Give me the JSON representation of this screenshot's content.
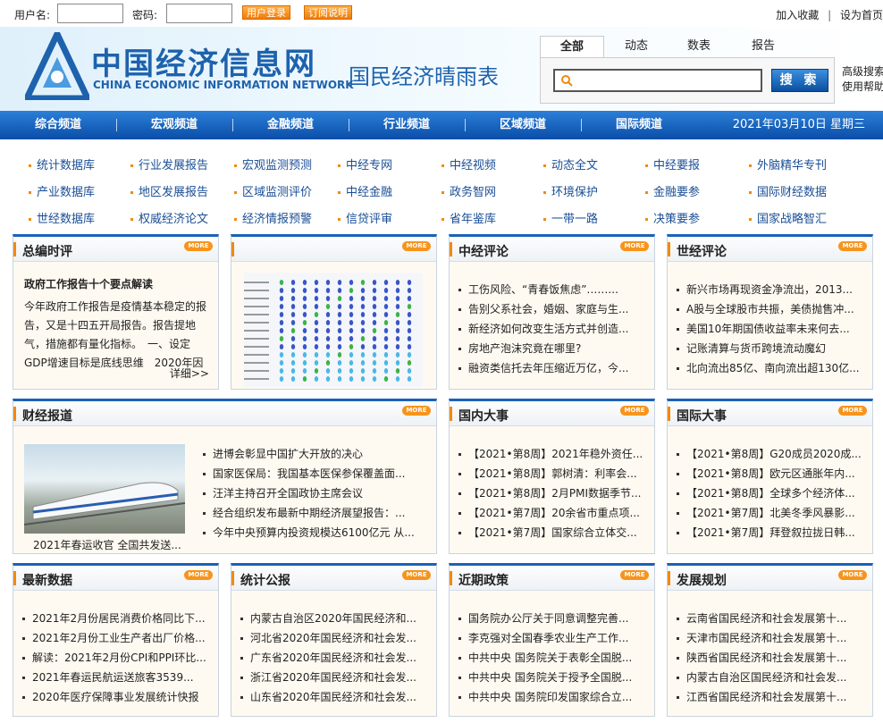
{
  "topbar": {
    "username_label": "用户名:",
    "password_label": "密码:",
    "login_label": "用户登录",
    "subscribe_label": "订阅说明",
    "favorite_label": "加入收藏",
    "sep": "|",
    "homepage_label": "设为首页"
  },
  "header": {
    "logo_cn": "中国经济信息网",
    "logo_en": "CHINA ECONOMIC INFORMATION NETWORK",
    "slogan": "国民经济晴雨表"
  },
  "search": {
    "tabs": [
      "全部",
      "动态",
      "数表",
      "报告"
    ],
    "button": "搜 索",
    "advanced": "高级搜索",
    "help": "使用帮助",
    "placeholder": ""
  },
  "nav": {
    "items": [
      "综合频道",
      "宏观频道",
      "金融频道",
      "行业频道",
      "区域频道",
      "国际频道"
    ],
    "date": "2021年03月10日 星期三"
  },
  "links": [
    [
      "统计数据库",
      "行业发展报告",
      "宏观监测预测",
      "中经专网",
      "中经视频",
      "动态全文",
      "中经要报",
      "外脑精华专刊"
    ],
    [
      "产业数据库",
      "地区发展报告",
      "区域监测评价",
      "中经金融",
      "政务智网",
      "环境保护",
      "金融要参",
      "国际财经数据"
    ],
    [
      "世经数据库",
      "权威经济论文",
      "经济情报预警",
      "信贷评审",
      "省年鉴库",
      "一带一路",
      "决策要参",
      "国家战略智汇"
    ]
  ],
  "more": "MORE",
  "section1": {
    "zongbian": {
      "title": "总编时评",
      "headline": "政府工作报告十个要点解读",
      "text": "今年政府工作报告是疫情基本稳定的报告，又是十四五开局报告。报告提地气，措施都有量化指标。　一、设定GDP增速目标是底线思维　2020年因疫情...",
      "detail": "详细>>"
    },
    "zhongjing_index": {
      "title": "中经指数"
    },
    "zhongjing_review": {
      "title": "中经评论",
      "items": [
        "工伤风险、“青春饭焦虑”……...",
        "告别父系社会，婚姻、家庭与生...",
        "新经济如何改变生活方式并创造...",
        "房地产泡沫究竟在哪里?",
        "融资类信托去年压缩近万亿，今..."
      ]
    },
    "shijing_review": {
      "title": "世经评论",
      "items": [
        "新兴市场再现资金净流出，2013...",
        "A股与全球股市共振，美债抛售冲...",
        "美国10年期国债收益率未来何去...",
        "记账清算与货币跨境流动魔幻",
        "北向流出85亿、南向流出超130亿..."
      ]
    }
  },
  "section2": {
    "caijing": {
      "title": "财经报道",
      "caption": "2021年春运收官 全国共发送...",
      "items": [
        "进博会彰显中国扩大开放的决心",
        "国家医保局：我国基本医保参保覆盖面...",
        "汪洋主持召开全国政协主席会议",
        "经合组织发布最新中期经济展望报告：...",
        "今年中央预算内投资规模达6100亿元 从..."
      ]
    },
    "guonei": {
      "title": "国内大事",
      "items": [
        "【2021•第8周】2021年稳外资任...",
        "【2021•第8周】郭树清：利率会...",
        "【2021•第8周】2月PMI数据季节...",
        "【2021•第7周】20余省市重点项...",
        "【2021•第7周】国家综合立体交..."
      ]
    },
    "guoji": {
      "title": "国际大事",
      "items": [
        "【2021•第8周】G20成员2020成...",
        "【2021•第8周】欧元区通胀年内...",
        "【2021•第8周】全球多个经济体...",
        "【2021•第7周】北美冬季风暴影...",
        "【2021•第7周】拜登叙拉拢日韩..."
      ]
    }
  },
  "section3": {
    "latest": {
      "title": "最新数据",
      "items": [
        "2021年2月份居民消费价格同比下...",
        "2021年2月份工业生产者出厂价格...",
        "解读：2021年2月份CPI和PPI环比...",
        "2021年春运民航运送旅客3539...",
        "2020年医疗保障事业发展统计快报"
      ]
    },
    "bulletin": {
      "title": "统计公报",
      "items": [
        "内蒙古自治区2020年国民经济和...",
        "河北省2020年国民经济和社会发...",
        "广东省2020年国民经济和社会发...",
        "浙江省2020年国民经济和社会发...",
        "山东省2020年国民经济和社会发..."
      ]
    },
    "policy": {
      "title": "近期政策",
      "items": [
        "国务院办公厅关于同意调整完善...",
        "李克强对全国春季农业生产工作...",
        "中共中央 国务院关于表彰全国脱...",
        "中共中央 国务院关于授予全国脱...",
        "中共中央 国务院印发国家综合立..."
      ]
    },
    "plan": {
      "title": "发展规划",
      "items": [
        "云南省国民经济和社会发展第十...",
        "天津市国民经济和社会发展第十...",
        "陕西省国民经济和社会发展第十...",
        "内蒙古自治区国民经济和社会发...",
        "江西省国民经济和社会发展第十..."
      ]
    }
  },
  "colors": {
    "brand_blue": "#1e62ad",
    "nav_blue": "#0a4ea8",
    "accent_orange": "#f08a12",
    "body_bg": "#fffaf1"
  }
}
